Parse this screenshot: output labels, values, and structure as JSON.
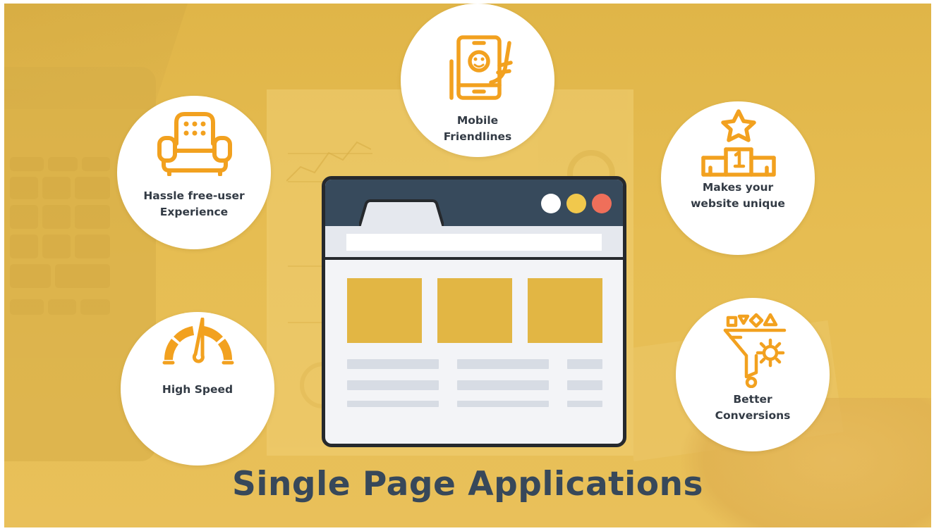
{
  "title": "Single Page Applications",
  "colors": {
    "background": "#e6bd52",
    "icon_orange": "#f2a11f",
    "text_dark": "#333b45",
    "title": "#37485a",
    "browser_header": "#374a5c",
    "browser_card": "#e2b644",
    "dot_white": "#ffffff",
    "dot_yellow": "#f1c84c",
    "dot_red": "#ef6f5a"
  },
  "features": {
    "hassle": {
      "label": "Hassle free-user\nExperience",
      "icon": "armchair-icon"
    },
    "mobile": {
      "label": "Mobile\nFriendlines",
      "icon": "smartphone-hand-icon"
    },
    "unique": {
      "label": "Makes your\nwebsite unique",
      "icon": "podium-star-icon"
    },
    "speed": {
      "label": "High Speed",
      "icon": "speedometer-icon"
    },
    "conversions": {
      "label": "Better\nConversions",
      "icon": "funnel-gear-icon"
    }
  },
  "browser": {
    "window_dots": [
      "white",
      "yellow",
      "red"
    ]
  }
}
